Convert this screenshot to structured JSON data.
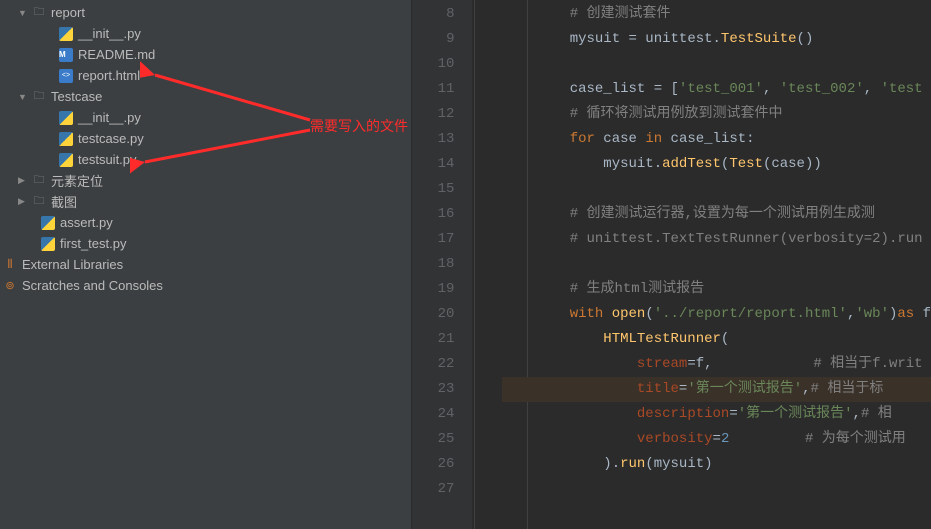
{
  "tree": {
    "report": "report",
    "init1": "__init__.py",
    "readme": "README.md",
    "reportHtml": "report.html",
    "testcase": "Testcase",
    "init2": "__init__.py",
    "testcasePy": "testcase.py",
    "testsuitPy": "testsuit.py",
    "yuansu": "元素定位",
    "jietu": "截图",
    "assertPy": "assert.py",
    "firstTest": "first_test.py",
    "extLib": "External Libraries",
    "scratches": "Scratches and Consoles"
  },
  "annotation": "需要写入的文件",
  "gutter": [
    "8",
    "9",
    "10",
    "11",
    "12",
    "13",
    "14",
    "15",
    "16",
    "17",
    "18",
    "19",
    "20",
    "21",
    "22",
    "23",
    "24",
    "25",
    "26",
    "27"
  ],
  "code": {
    "l8_comment": "# 创建测试套件",
    "l9_a": "mysuit ",
    "l9_b": "=",
    "l9_c": " unittest.",
    "l9_d": "TestSuite",
    "l9_e": "()",
    "l11_a": "case_list ",
    "l11_b": "=",
    "l11_c": " [",
    "l11_s1": "'test_001'",
    "l11_comma1": ", ",
    "l11_s2": "'test_002'",
    "l11_comma2": ", ",
    "l11_s3": "'test",
    "l12_comment": "# 循环将测试用例放到测试套件中",
    "l13_for": "for",
    "l13_a": " case ",
    "l13_in": "in",
    "l13_b": " case_list:",
    "l14_a": "    mysuit.",
    "l14_b": "addTest",
    "l14_c": "(",
    "l14_d": "Test",
    "l14_e": "(case))",
    "l16_comment": "# 创建测试运行器,设置为每一个测试用例生成测",
    "l17_comment": "# unittest.TextTestRunner(verbosity=2).run",
    "l19_comment": "# 生成html测试报告",
    "l20_with": "with",
    "l20_a": " ",
    "l20_open": "open",
    "l20_b": "(",
    "l20_s1": "'../report/report.html'",
    "l20_comma": ",",
    "l20_s2": "'wb'",
    "l20_c": ")",
    "l20_as": "as",
    "l20_d": " f",
    "l21_a": "    ",
    "l21_b": "HTMLTestRunner",
    "l21_c": "(",
    "l22_pad": "        ",
    "l22_param": "stream",
    "l22_eq": "=",
    "l22_val": "f",
    "l22_comma": ",",
    "l22_sp": "            ",
    "l22_comment": "# 相当于f.writ",
    "l23_pad": "        ",
    "l23_param": "title",
    "l23_eq": "=",
    "l23_val": "'第一个测试报告'",
    "l23_comma": ",",
    "l23_comment": "# 相当于标",
    "l24_pad": "        ",
    "l24_param": "description",
    "l24_eq": "=",
    "l24_val": "'第一个测试报告'",
    "l24_comma": ",",
    "l24_comment": "# 相",
    "l25_pad": "        ",
    "l25_param": "verbosity",
    "l25_eq": "=",
    "l25_val": "2",
    "l25_sp": "         ",
    "l25_comment": "# 为每个测试用",
    "l26_a": "    ).",
    "l26_b": "run",
    "l26_c": "(mysuit)"
  }
}
